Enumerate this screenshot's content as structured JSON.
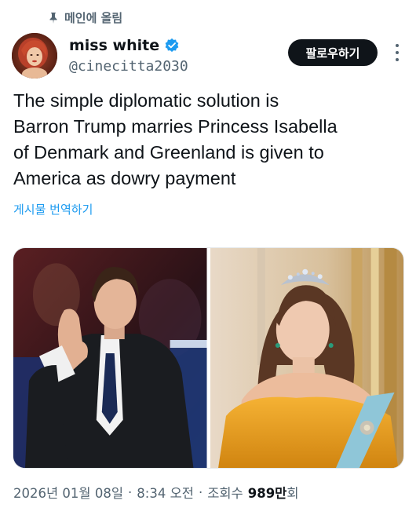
{
  "pinned": {
    "label": "메인에 올림",
    "icon": "pin-icon"
  },
  "author": {
    "display_name": "miss white",
    "handle": "@cinecitta2030",
    "verified": true,
    "verified_color": "#1d9bf0",
    "avatar_icon": "avatar"
  },
  "follow_button": {
    "label": "팔로우하기"
  },
  "more_icon": "more-options-icon",
  "tweet": {
    "text": "The simple diplomatic solution is\nBarron Trump marries Princess Isabella\nof Denmark and Greenland is given to\nAmerica as dowry payment",
    "translate_label": "게시물 번역하기"
  },
  "media": {
    "count": 2
  },
  "meta": {
    "date": "2026년 01월 08일",
    "separator": "·",
    "time": "8:34 오전",
    "views_label": "조회수",
    "views_count": "989만",
    "views_suffix": "회"
  },
  "colors": {
    "text_primary": "#0f1419",
    "text_secondary": "#536471",
    "accent": "#1d9bf0",
    "button_bg": "#0f1419"
  }
}
